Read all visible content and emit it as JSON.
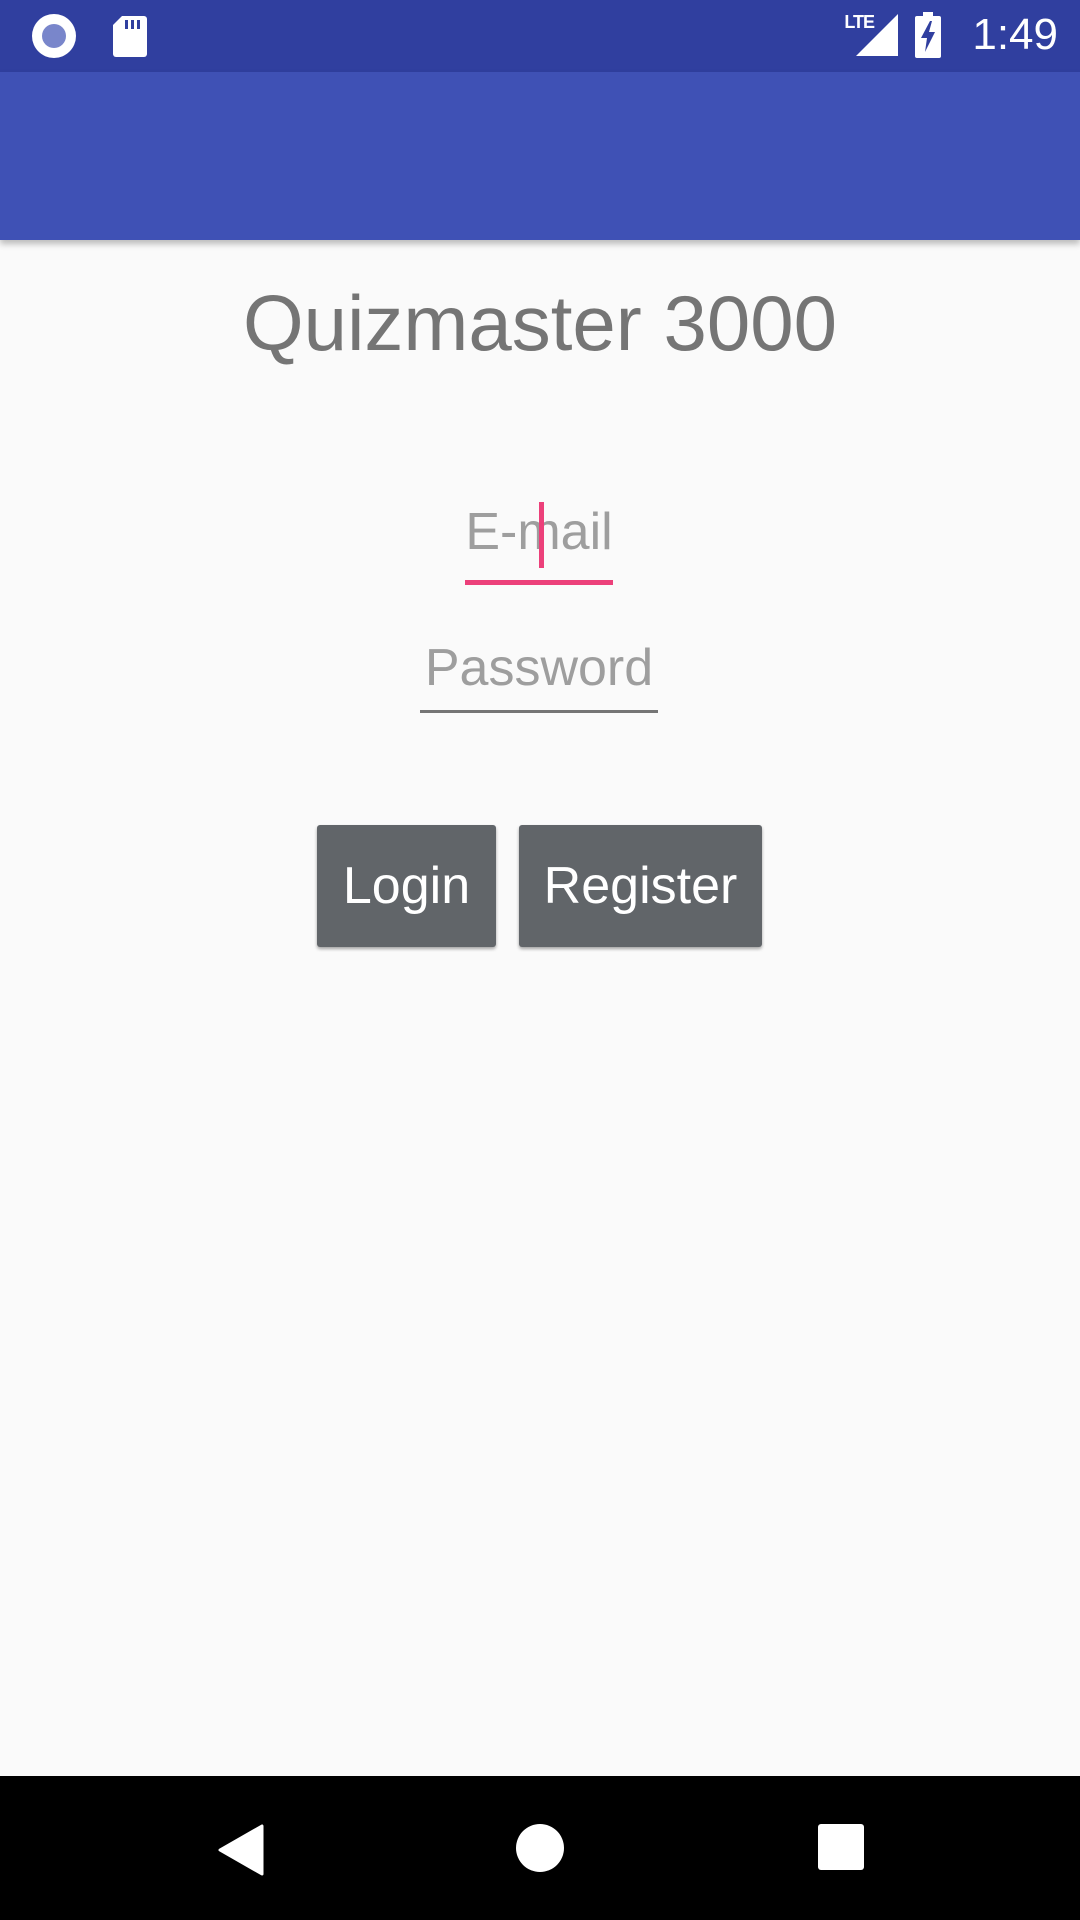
{
  "status_bar": {
    "time": "1:49",
    "network": "LTE",
    "icons": [
      "notification-circle-icon",
      "sd-card-icon",
      "signal-icon",
      "battery-charging-icon"
    ]
  },
  "main": {
    "title": "Quizmaster 3000",
    "email": {
      "value": "",
      "placeholder": "E-mail"
    },
    "password": {
      "value": "",
      "placeholder": "Password"
    },
    "login_label": "Login",
    "register_label": "Register"
  },
  "colors": {
    "status_bar": "#303F9F",
    "app_bar": "#3F51B5",
    "accent": "#EC407A",
    "button": "#616569",
    "background": "#FAFAFA"
  },
  "nav_bar": {
    "icons": [
      "back-icon",
      "home-icon",
      "recents-icon"
    ]
  }
}
